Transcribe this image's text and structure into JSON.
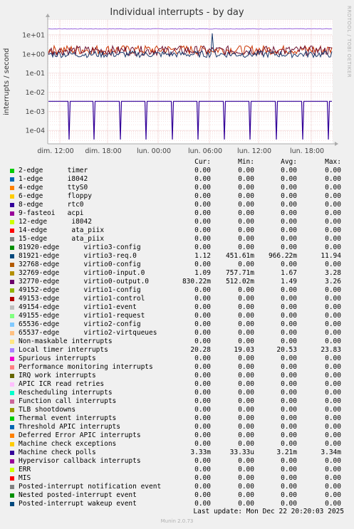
{
  "title": "Individual interrupts - by day",
  "side_label": "RRDTOOL / TOBI OETIKER",
  "munin_version": "Munin 2.0.73",
  "last_update": "Last update: Mon Dec 22 20:20:03 2025",
  "columns": [
    "Cur:",
    "Min:",
    "Avg:",
    "Max:"
  ],
  "chart_data": {
    "type": "line",
    "title": "Individual interrupts - by day",
    "ylabel": "interrupts / second",
    "yscale": "log",
    "ylim": [
      2e-05,
      60
    ],
    "ytick_values": [
      10,
      1,
      0.1,
      0.01,
      0.001,
      0.0001
    ],
    "ytick_labels": [
      "1e+01",
      "1e+00",
      "1e-01",
      "1e-02",
      "1e-03",
      "1e-04"
    ],
    "xtick_labels": [
      "dim. 12:00",
      "dim. 18:00",
      "lun. 00:00",
      "lun. 06:00",
      "lun. 12:00",
      "lun. 18:00"
    ],
    "grid": true,
    "series": [
      {
        "name": "Local timer interrupts",
        "color": "#9966dd",
        "cur": 20.28,
        "min": 19.03,
        "avg": 20.53,
        "max": 23.83
      },
      {
        "name": "81921-edge virtio3-req.0",
        "color": "#1a3b6e",
        "cur": 1.12,
        "min": 0.45161,
        "avg": 0.96622,
        "max": 11.94
      },
      {
        "name": "32769-edge virtio0-input.0",
        "color": "#cc3300",
        "cur": 1.09,
        "min": 0.75771,
        "avg": 1.67,
        "max": 3.28
      },
      {
        "name": "32770-edge virtio0-output.0",
        "color": "#6b0f2e",
        "cur": 0.83022,
        "min": 0.51202,
        "avg": 1.49,
        "max": 3.26
      },
      {
        "name": "Machine check polls",
        "color": "#330099",
        "cur": 0.00333,
        "min": 3.333e-05,
        "avg": 0.00321,
        "max": 0.00334
      }
    ]
  },
  "legend": [
    {
      "color": "#00cc00",
      "name": "2-edge      timer",
      "cur": "0.00",
      "min": "0.00",
      "avg": "0.00",
      "max": "0.00"
    },
    {
      "color": "#0066b3",
      "name": "1-edge      i8042",
      "cur": "0.00",
      "min": "0.00",
      "avg": "0.00",
      "max": "0.00"
    },
    {
      "color": "#ff8000",
      "name": "4-edge      ttyS0",
      "cur": "0.00",
      "min": "0.00",
      "avg": "0.00",
      "max": "0.00"
    },
    {
      "color": "#ffcc00",
      "name": "6-edge      floppy",
      "cur": "0.00",
      "min": "0.00",
      "avg": "0.00",
      "max": "0.00"
    },
    {
      "color": "#330099",
      "name": "8-edge      rtc0",
      "cur": "0.00",
      "min": "0.00",
      "avg": "0.00",
      "max": "0.00"
    },
    {
      "color": "#990099",
      "name": "9-fasteoi   acpi",
      "cur": "0.00",
      "min": "0.00",
      "avg": "0.00",
      "max": "0.00"
    },
    {
      "color": "#ccff00",
      "name": "12-edge      i8042",
      "cur": "0.00",
      "min": "0.00",
      "avg": "0.00",
      "max": "0.00"
    },
    {
      "color": "#ff0000",
      "name": "14-edge      ata_piix",
      "cur": "0.00",
      "min": "0.00",
      "avg": "0.00",
      "max": "0.00"
    },
    {
      "color": "#808080",
      "name": "15-edge      ata_piix",
      "cur": "0.00",
      "min": "0.00",
      "avg": "0.00",
      "max": "0.00"
    },
    {
      "color": "#008f00",
      "name": "81920-edge      virtio3-config",
      "cur": "0.00",
      "min": "0.00",
      "avg": "0.00",
      "max": "0.00"
    },
    {
      "color": "#00487d",
      "name": "81921-edge      virtio3-req.0",
      "cur": "1.12",
      "min": "451.61m",
      "avg": "966.22m",
      "max": "11.94"
    },
    {
      "color": "#b35a00",
      "name": "32768-edge      virtio0-config",
      "cur": "0.00",
      "min": "0.00",
      "avg": "0.00",
      "max": "0.00"
    },
    {
      "color": "#b38f00",
      "name": "32769-edge      virtio0-input.0",
      "cur": "1.09",
      "min": "757.71m",
      "avg": "1.67",
      "max": "3.28"
    },
    {
      "color": "#6b006b",
      "name": "32770-edge      virtio0-output.0",
      "cur": "830.22m",
      "min": "512.02m",
      "avg": "1.49",
      "max": "3.26"
    },
    {
      "color": "#8fb300",
      "name": "49152-edge      virtio1-config",
      "cur": "0.00",
      "min": "0.00",
      "avg": "0.00",
      "max": "0.00"
    },
    {
      "color": "#b30000",
      "name": "49153-edge      virtio1-control",
      "cur": "0.00",
      "min": "0.00",
      "avg": "0.00",
      "max": "0.00"
    },
    {
      "color": "#bebebe",
      "name": "49154-edge      virtio1-event",
      "cur": "0.00",
      "min": "0.00",
      "avg": "0.00",
      "max": "0.00"
    },
    {
      "color": "#80ff80",
      "name": "49155-edge      virtio1-request",
      "cur": "0.00",
      "min": "0.00",
      "avg": "0.00",
      "max": "0.00"
    },
    {
      "color": "#80c9ff",
      "name": "65536-edge      virtio2-config",
      "cur": "0.00",
      "min": "0.00",
      "avg": "0.00",
      "max": "0.00"
    },
    {
      "color": "#ffc080",
      "name": "65537-edge      virtio2-virtqueues",
      "cur": "0.00",
      "min": "0.00",
      "avg": "0.00",
      "max": "0.00"
    },
    {
      "color": "#ffe680",
      "name": "Non-maskable interrupts",
      "cur": "0.00",
      "min": "0.00",
      "avg": "0.00",
      "max": "0.00"
    },
    {
      "color": "#aa80ff",
      "name": "Local timer interrupts",
      "cur": "20.28",
      "min": "19.03",
      "avg": "20.53",
      "max": "23.83"
    },
    {
      "color": "#ee00cc",
      "name": "Spurious interrupts",
      "cur": "0.00",
      "min": "0.00",
      "avg": "0.00",
      "max": "0.00"
    },
    {
      "color": "#ff8080",
      "name": "Performance monitoring interrupts",
      "cur": "0.00",
      "min": "0.00",
      "avg": "0.00",
      "max": "0.00"
    },
    {
      "color": "#666600",
      "name": "IRQ work interrupts",
      "cur": "0.00",
      "min": "0.00",
      "avg": "0.00",
      "max": "0.00"
    },
    {
      "color": "#ffbfff",
      "name": "APIC ICR read retries",
      "cur": "0.00",
      "min": "0.00",
      "avg": "0.00",
      "max": "0.00"
    },
    {
      "color": "#00ffcc",
      "name": "Rescheduling interrupts",
      "cur": "0.00",
      "min": "0.00",
      "avg": "0.00",
      "max": "0.00"
    },
    {
      "color": "#cc6699",
      "name": "Function call interrupts",
      "cur": "0.00",
      "min": "0.00",
      "avg": "0.00",
      "max": "0.00"
    },
    {
      "color": "#999900",
      "name": "TLB shootdowns",
      "cur": "0.00",
      "min": "0.00",
      "avg": "0.00",
      "max": "0.00"
    },
    {
      "color": "#00cc00",
      "name": "Thermal event interrupts",
      "cur": "0.00",
      "min": "0.00",
      "avg": "0.00",
      "max": "0.00"
    },
    {
      "color": "#0066b3",
      "name": "Threshold APIC interrupts",
      "cur": "0.00",
      "min": "0.00",
      "avg": "0.00",
      "max": "0.00"
    },
    {
      "color": "#ff8000",
      "name": "Deferred Error APIC interrupts",
      "cur": "0.00",
      "min": "0.00",
      "avg": "0.00",
      "max": "0.00"
    },
    {
      "color": "#ffcc00",
      "name": "Machine check exceptions",
      "cur": "0.00",
      "min": "0.00",
      "avg": "0.00",
      "max": "0.00"
    },
    {
      "color": "#330099",
      "name": "Machine check polls",
      "cur": "3.33m",
      "min": "33.33u",
      "avg": "3.21m",
      "max": "3.34m"
    },
    {
      "color": "#990099",
      "name": "Hypervisor callback interrupts",
      "cur": "0.00",
      "min": "0.00",
      "avg": "0.00",
      "max": "0.00"
    },
    {
      "color": "#ccff00",
      "name": "ERR",
      "cur": "0.00",
      "min": "0.00",
      "avg": "0.00",
      "max": "0.00"
    },
    {
      "color": "#ff0000",
      "name": "MIS",
      "cur": "0.00",
      "min": "0.00",
      "avg": "0.00",
      "max": "0.00"
    },
    {
      "color": "#808080",
      "name": "Posted-interrupt notification event",
      "cur": "0.00",
      "min": "0.00",
      "avg": "0.00",
      "max": "0.00"
    },
    {
      "color": "#008f00",
      "name": "Nested posted-interrupt event",
      "cur": "0.00",
      "min": "0.00",
      "avg": "0.00",
      "max": "0.00"
    },
    {
      "color": "#00487d",
      "name": "Posted-interrupt wakeup event",
      "cur": "0.00",
      "min": "0.00",
      "avg": "0.00",
      "max": "0.00"
    }
  ]
}
